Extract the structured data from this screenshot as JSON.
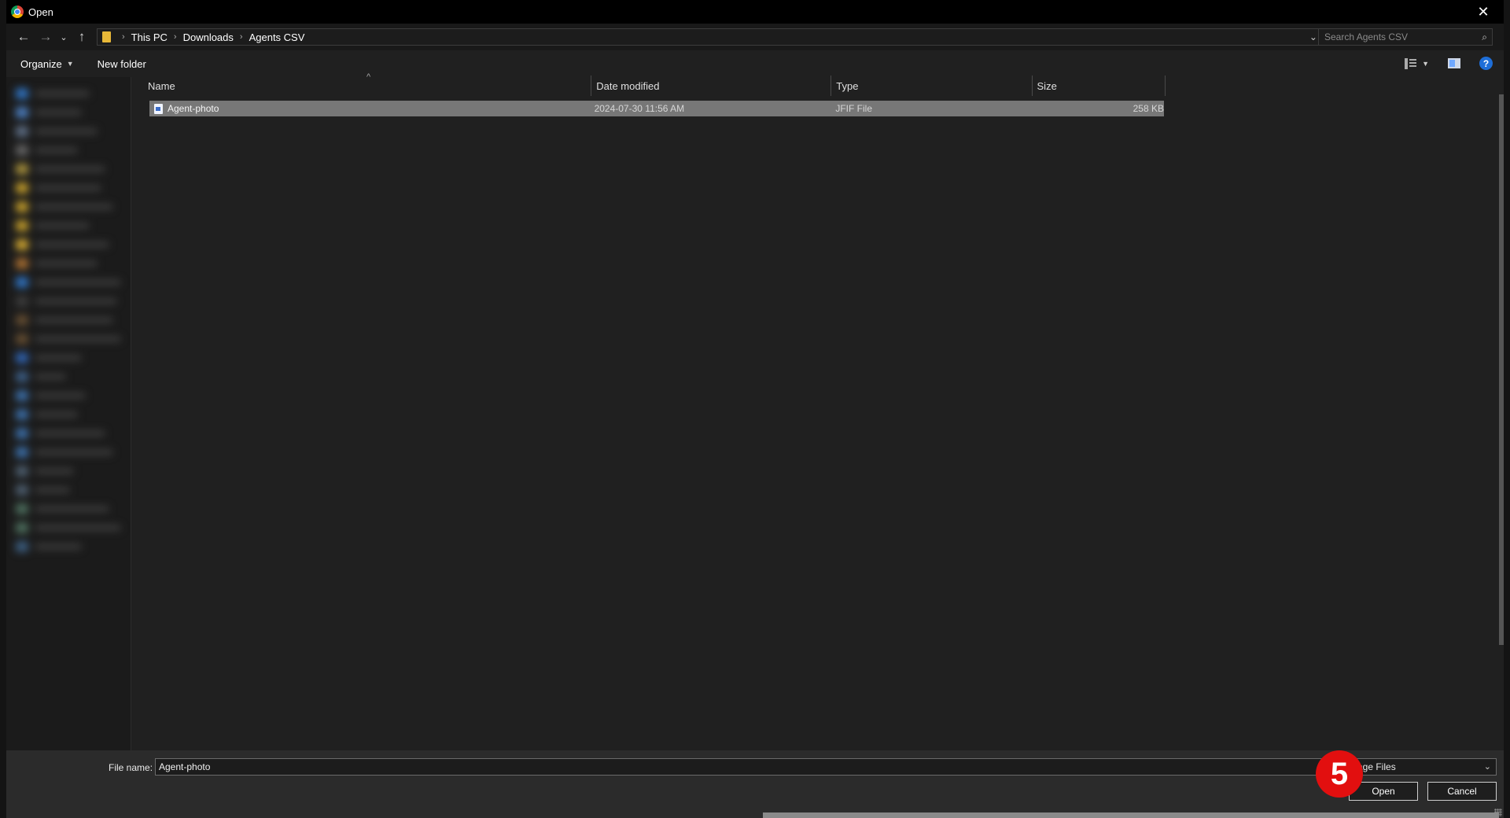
{
  "window": {
    "title": "Open",
    "close_glyph": "✕"
  },
  "nav": {
    "back_glyph": "←",
    "forward_glyph": "→",
    "recent_glyph": "⌄",
    "up_glyph": "↑",
    "breadcrumbs": [
      "This PC",
      "Downloads",
      "Agents CSV"
    ],
    "breadcrumb_sep": "›",
    "dropdown_glyph": "⌄",
    "refresh_glyph": "↻",
    "search_placeholder": "Search Agents CSV",
    "search_glyph": "⌕"
  },
  "toolbar": {
    "organize_label": "Organize",
    "new_folder_label": "New folder",
    "help_glyph": "?"
  },
  "columns": {
    "sort_glyph": "^",
    "headers": [
      "Name",
      "Date modified",
      "Type",
      "Size"
    ]
  },
  "files": [
    {
      "name": "Agent-photo",
      "date_modified": "2024-07-30 11:56 AM",
      "type": "JFIF File",
      "size": "258 KB",
      "selected": true
    }
  ],
  "bottom": {
    "file_name_label": "File name:",
    "file_name_value": "Agent-photo",
    "file_type_value": "age Files",
    "file_type_chevron": "⌄",
    "open_label": "Open",
    "cancel_label": "Cancel"
  },
  "annotation": {
    "step_number": "5",
    "color": "#e20f0f"
  },
  "colors": {
    "selected_row": "#777777",
    "background": "#202020",
    "titlebar": "#000000"
  }
}
